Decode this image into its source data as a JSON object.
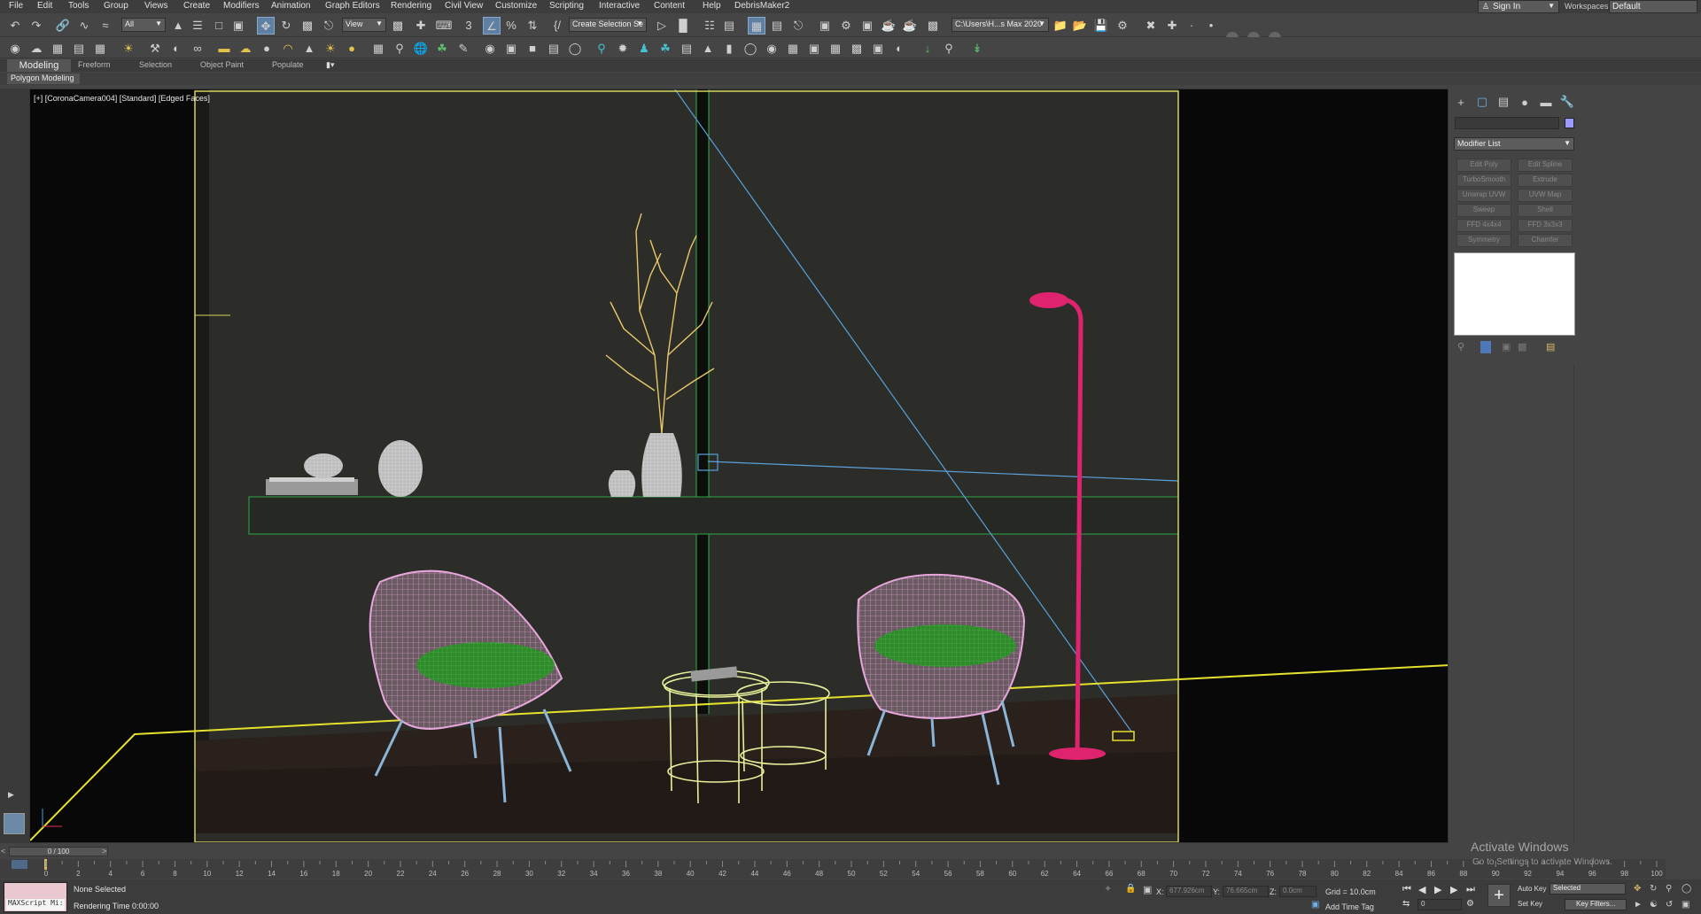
{
  "menu": [
    "File",
    "Edit",
    "Tools",
    "Group",
    "Views",
    "Create",
    "Modifiers",
    "Animation",
    "Graph Editors",
    "Rendering",
    "Civil View",
    "Customize",
    "Scripting",
    "Interactive",
    "Content",
    "Help",
    "DebrisMaker2"
  ],
  "account": {
    "sign_in": "Sign In",
    "workspaces_label": "Workspaces:",
    "workspace": "Default"
  },
  "toolbar": {
    "selection_filter": "All",
    "ref_coord": "View",
    "named_selection": "Create Selection Se",
    "project_path": "C:\\Users\\H...s Max 2020"
  },
  "ribbon": {
    "tabs": [
      "Modeling",
      "Freeform",
      "Selection",
      "Object Paint",
      "Populate"
    ],
    "panel": "Polygon Modeling"
  },
  "viewport": {
    "label": "[+] [CoronaCamera004] [Standard] [Edged Faces]",
    "colors": {
      "frame": "#d6d35a",
      "chair": "#e7a6dc",
      "cushion": "#2e8c2a",
      "lamp": "#e0236f",
      "table": "#e9f09a",
      "branches": "#e8c76b",
      "camera_line": "#5aa0dc",
      "floor": "#2a211c"
    }
  },
  "command_panel": {
    "modifier_list": "Modifier List",
    "modifiers": [
      "Edit Poly",
      "Edit Spline",
      "TurboSmooth",
      "Extrude",
      "Unwrap UVW",
      "UVW Map",
      "Sweep",
      "Shell",
      "FFD 4x4x4",
      "FFD 3x3x3",
      "Symmetry",
      "Chamfer"
    ]
  },
  "timeline": {
    "frame_display": "0 / 100",
    "ticks": [
      "0",
      "2",
      "4",
      "6",
      "8",
      "10",
      "12",
      "14",
      "16",
      "18",
      "20",
      "22",
      "24",
      "26",
      "28",
      "30",
      "32",
      "34",
      "36",
      "38",
      "40",
      "42",
      "44",
      "46",
      "48",
      "50",
      "52",
      "54",
      "56",
      "58",
      "60",
      "62",
      "64",
      "66",
      "68",
      "70",
      "72",
      "74",
      "76",
      "78",
      "80",
      "82",
      "84",
      "86",
      "88",
      "90",
      "92",
      "94",
      "96",
      "98",
      "100"
    ]
  },
  "status": {
    "maxscript_prompt": "MAXScript Mi:",
    "selection": "None Selected",
    "rendering_time": "Rendering Time  0:00:00",
    "x_label": "X:",
    "x_value": "677.926cm",
    "y_label": "Y:",
    "y_value": "76.665cm",
    "z_label": "Z:",
    "z_value": "0.0cm",
    "grid": "Grid = 10.0cm",
    "add_time_tag": "Add Time Tag",
    "auto_key": "Auto Key",
    "set_key": "Set Key",
    "key_mode": "Selected",
    "key_filters": "Key Filters...",
    "current_frame": "0"
  },
  "watermark": {
    "title": "Activate Windows",
    "subtitle": "Go to Settings to activate Windows."
  }
}
